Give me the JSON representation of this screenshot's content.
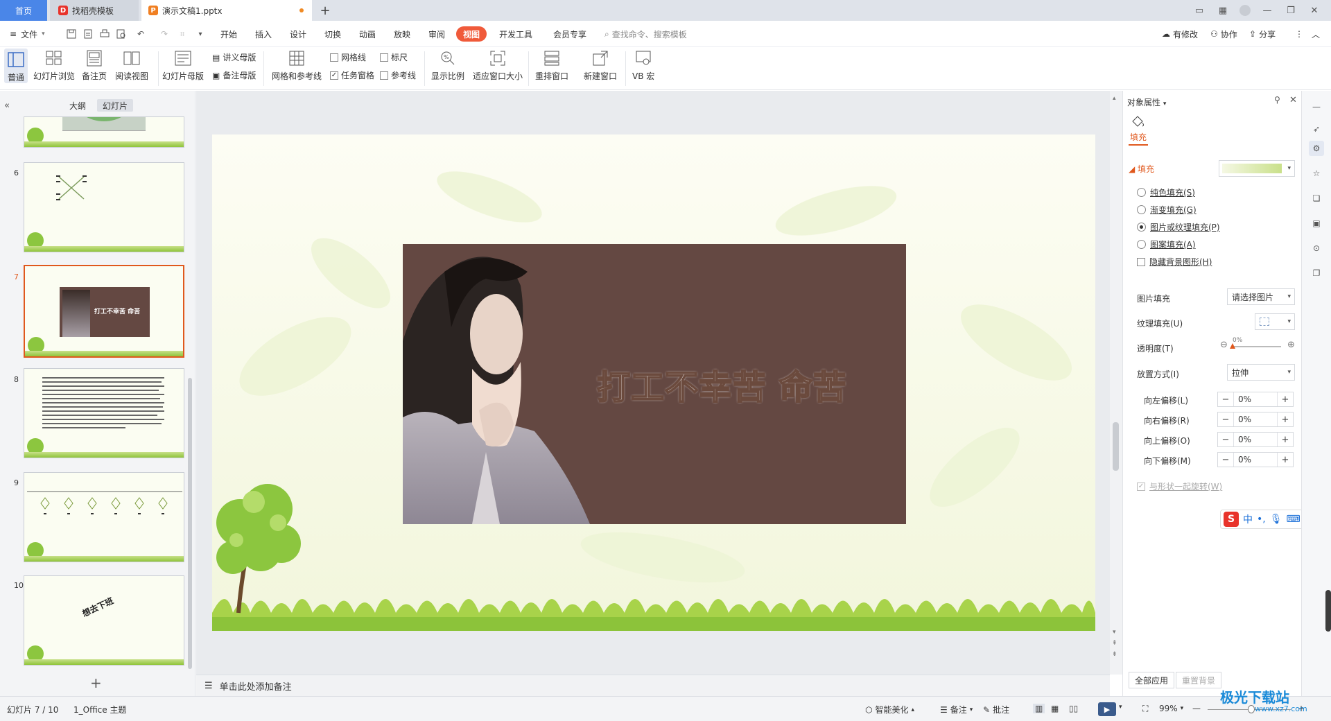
{
  "titlebar": {
    "tabs": [
      {
        "label": "首页"
      },
      {
        "label": "找稻壳模板"
      },
      {
        "label": "演示文稿1.pptx"
      }
    ]
  },
  "menubar": {
    "file": "文件",
    "items": [
      "开始",
      "插入",
      "设计",
      "切换",
      "动画",
      "放映",
      "审阅",
      "视图",
      "开发工具",
      "会员专享"
    ],
    "active": "视图",
    "search_placeholder": "查找命令、搜索模板",
    "right_items": [
      "有修改",
      "协作",
      "分享"
    ]
  },
  "ribbon": {
    "buttons": {
      "normal": "普通",
      "slide_sorter": "幻灯片浏览",
      "notes_page": "备注页",
      "reading_view": "阅读视图",
      "slide_master": "幻灯片母版",
      "handout_master": "讲义母版",
      "notes_master": "备注母版",
      "grid_guides": "网格和参考线",
      "gridlines": "网格线",
      "ruler": "标尺",
      "task_pane": "任务窗格",
      "guides": "参考线",
      "zoom": "显示比例",
      "fit_window": "适应窗口大小",
      "arrange": "重排窗口",
      "new_window": "新建窗口",
      "vb_macro": "VB 宏"
    },
    "checks": {
      "gridlines": false,
      "ruler": false,
      "task_pane": true,
      "guides": false
    }
  },
  "leftpanel": {
    "tab_outline": "大纲",
    "tab_slides": "幻灯片",
    "slides": [
      {
        "num": "6"
      },
      {
        "num": "7",
        "selected": true,
        "caption": "打工不幸苦 命苦"
      },
      {
        "num": "8"
      },
      {
        "num": "9"
      },
      {
        "num": "10",
        "caption": "想去下班"
      }
    ],
    "add_label": "+"
  },
  "slide": {
    "text": "打工不幸苦 命苦"
  },
  "notes": {
    "placeholder": "单击此处添加备注"
  },
  "rightpanel": {
    "title": "对象属性",
    "tab_fill": "填充",
    "section_fill": "填充",
    "options": [
      {
        "label": "纯色填充(S)",
        "checked": false
      },
      {
        "label": "渐变填充(G)",
        "checked": false
      },
      {
        "label": "图片或纹理填充(P)",
        "checked": true
      },
      {
        "label": "图案填充(A)",
        "checked": false
      }
    ],
    "hide_bg": "隐藏背景图形(H)",
    "picture_fill_label": "图片填充",
    "picture_fill_value": "请选择图片",
    "texture_fill_label": "纹理填充(U)",
    "transparency_label": "透明度(T)",
    "transparency_value": "0%",
    "transparency_level": 0,
    "placement_label": "放置方式(I)",
    "placement_value": "拉伸",
    "offsets": [
      {
        "label": "向左偏移(L)",
        "value": "0%"
      },
      {
        "label": "向右偏移(R)",
        "value": "0%"
      },
      {
        "label": "向上偏移(O)",
        "value": "0%"
      },
      {
        "label": "向下偏移(M)",
        "value": "0%"
      }
    ],
    "rotate_with_shape": "与形状一起旋转(W)",
    "apply_all": "全部应用",
    "reset_bg": "重置背景"
  },
  "statusbar": {
    "slide_info": "幻灯片 7 / 10",
    "theme": "1_Office 主题",
    "smart": "智能美化",
    "notes": "备注",
    "comments": "批注",
    "zoom": "99%"
  },
  "ime": {
    "label": "中"
  },
  "watermark": {
    "title": "极光下载站",
    "url": "www.xz7.com"
  }
}
